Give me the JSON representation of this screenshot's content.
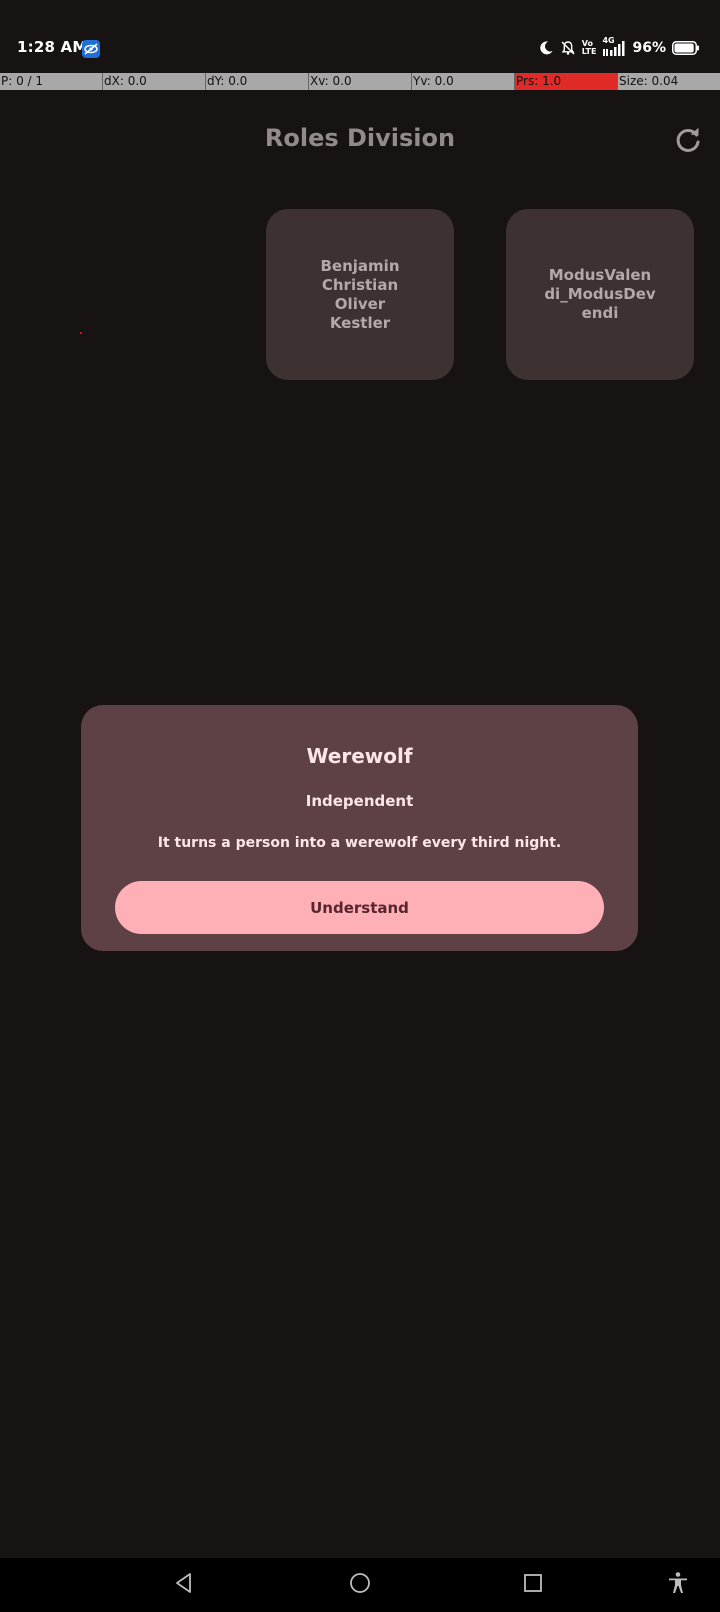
{
  "status_bar": {
    "time": "1:28 AM",
    "network_label_top": "4G",
    "volte_label": "Vo LTE",
    "battery_percent": "96%",
    "battery_level": 0.96,
    "icons": [
      "app-notification-icon",
      "moon-icon",
      "bell-off-icon",
      "volte-icon",
      "signal-icon",
      "battery-icon"
    ]
  },
  "pointer_overlay": {
    "cells": [
      "P: 0 / 1",
      "dX: 0.0",
      "dY: 0.0",
      "Xv: 0.0",
      "Yv: 0.0",
      "Prs: 1.0",
      "Size: 0.04"
    ]
  },
  "header": {
    "title": "Roles Division",
    "refresh_icon": "refresh-icon"
  },
  "players": [
    {
      "name": "Benjamin\nChristian\nOliver\nKestler"
    },
    {
      "name": "ModusValen\ndi_ModusDev\nendi"
    }
  ],
  "dialog": {
    "title": "Werewolf",
    "subtitle": "Independent",
    "description": "It turns a person into a werewolf every third night.",
    "button_label": "Understand"
  },
  "nav_bar": {
    "icons": [
      "back-icon",
      "home-icon",
      "recents-icon",
      "accessibility-icon"
    ]
  },
  "colors": {
    "background": "#171313",
    "card": "#3e3131",
    "dialog": "#5e4145",
    "button": "#ffb0b6",
    "overlay_alert": "#e02a27"
  }
}
